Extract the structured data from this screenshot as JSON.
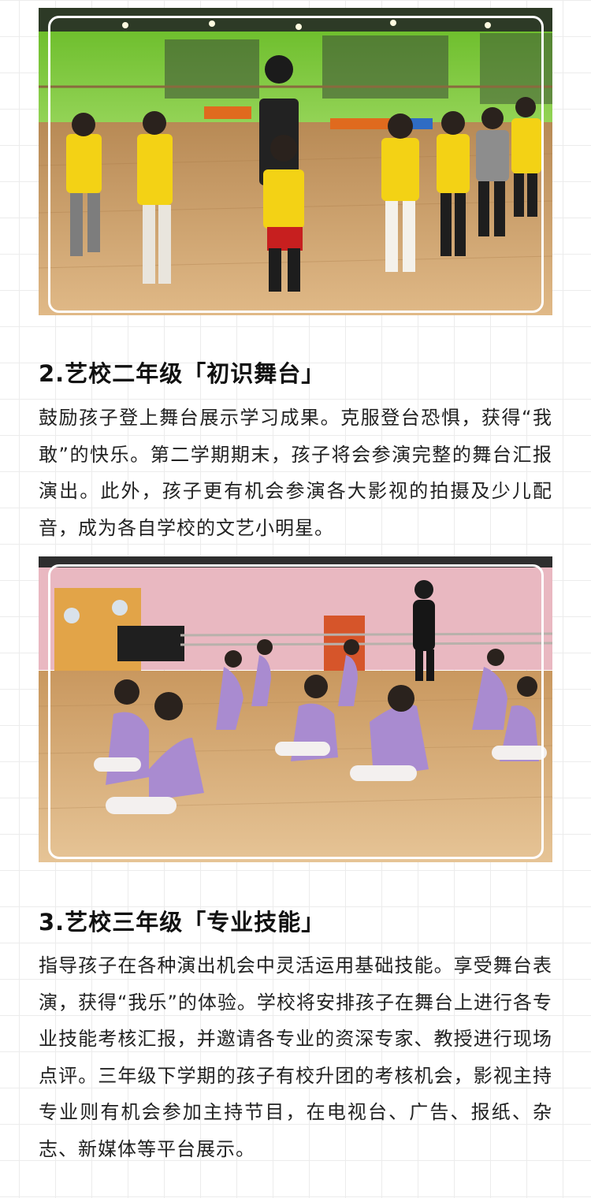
{
  "section2": {
    "heading": "2.艺校二年级「初识舞台」",
    "body": "鼓励孩子登上舞台展示学习成果。克服登台恐惧，获得“我敢”的快乐。第二学期期末，孩子将会参演完整的舞台汇报演出。此外，孩子更有机会参演各大影视的拍摄及少儿配音，成为各自学校的文艺小明星。"
  },
  "section3": {
    "heading": "3.艺校三年级「专业技能」",
    "body": "指导孩子在各种演出机会中灵活运用基础技能。享受舞台表演，获得“我乐”的体验。学校将安排孩子在舞台上进行各专业技能考核汇报，并邀请各专业的资深专家、教授进行现场点评。三年级下学期的孩子有校升团的考核机会，影视主持专业则有机会参加主持节目，在电视台、广告、报纸、杂志、新媒体等平台展示。"
  },
  "colors": {
    "page_background": "#ffffff",
    "grid_line": "#ececec",
    "text": "#1c1c1c",
    "photo_frame": "#ffffff",
    "studio1_wall": "#7fc83a",
    "studio1_floor": "#c99a62",
    "uniform_yellow": "#f3d215",
    "studio2_wall": "#eab7c0",
    "studio2_floor": "#d9ae7c",
    "leotard_purple": "#a98bd0"
  }
}
